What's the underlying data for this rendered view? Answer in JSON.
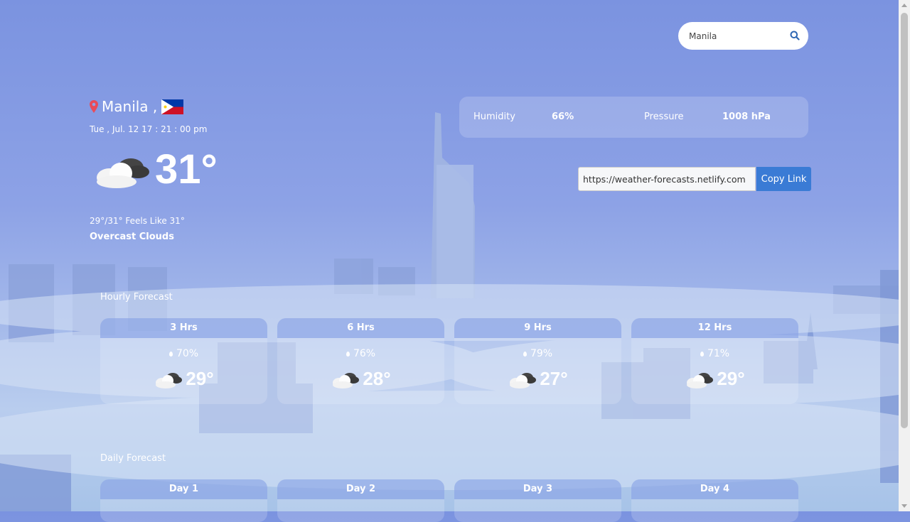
{
  "search": {
    "value": "Manila",
    "placeholder": ""
  },
  "location": {
    "city": "Manila ,",
    "flag": "philippines-flag-icon"
  },
  "datetime": "Tue , Jul. 12  17 : 21 : 00  pm",
  "current": {
    "temp": "31°",
    "icon": "cloud-icon",
    "feels_like": "29°/31° Feels Like 31°",
    "description": "Overcast Clouds"
  },
  "stats": {
    "humidity_label": "Humidity",
    "humidity_value": "66%",
    "pressure_label": "Pressure",
    "pressure_value": "1008 hPa"
  },
  "share": {
    "url": "https://weather-forecasts.netlify.com",
    "copy_label": "Copy Link"
  },
  "hourly": {
    "title": "Hourly Forecast",
    "items": [
      {
        "label": "3 Hrs",
        "humidity": "70%",
        "temp": "29°"
      },
      {
        "label": "6 Hrs",
        "humidity": "76%",
        "temp": "28°"
      },
      {
        "label": "9 Hrs",
        "humidity": "79%",
        "temp": "27°"
      },
      {
        "label": "12 Hrs",
        "humidity": "71%",
        "temp": "29°"
      }
    ]
  },
  "daily": {
    "title": "Daily Forecast",
    "items": [
      {
        "label": "Day 1"
      },
      {
        "label": "Day 2"
      },
      {
        "label": "Day 3"
      },
      {
        "label": "Day 4"
      }
    ]
  },
  "colors": {
    "accent": "#3a7bd5",
    "pin": "#e84b5a"
  }
}
